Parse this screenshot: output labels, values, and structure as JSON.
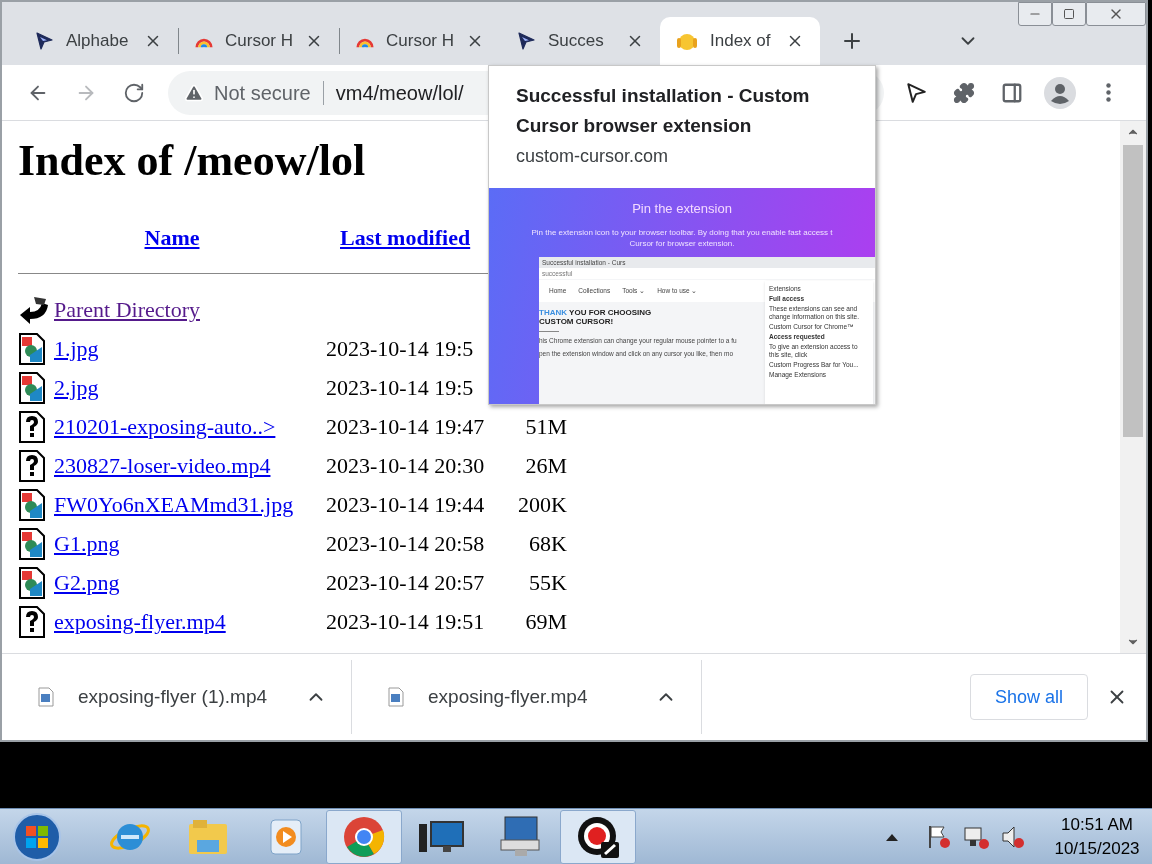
{
  "window_controls": [
    {
      "kind": "minimize"
    },
    {
      "kind": "maximize"
    },
    {
      "kind": "close"
    }
  ],
  "tabs": [
    {
      "title": "Alphabe",
      "kind": "cursor",
      "selected": false
    },
    {
      "title": "Cursor H",
      "kind": "rainbow",
      "selected": false
    },
    {
      "title": "Cursor H",
      "kind": "rainbow",
      "selected": false
    },
    {
      "title": "Succes",
      "kind": "cursor",
      "selected": false
    },
    {
      "title": "Index of",
      "kind": "emoji",
      "selected": true
    }
  ],
  "nav": [
    {
      "kind": "back",
      "disabled": false
    },
    {
      "kind": "forward",
      "disabled": true
    },
    {
      "kind": "reload",
      "disabled": false
    }
  ],
  "address": {
    "security": "Not secure",
    "url": "vm4/meow/lol/"
  },
  "toolbar_icons": [
    {
      "kind": "cursor"
    },
    {
      "kind": "extensions"
    },
    {
      "kind": "sidebar"
    },
    {
      "kind": "profile"
    },
    {
      "kind": "menu"
    }
  ],
  "page": {
    "heading": "Index of /meow/lol",
    "columns": [
      "Name",
      "Last modified"
    ],
    "entries": [
      {
        "kind": "parent",
        "name": "Parent Directory"
      },
      {
        "kind": "image",
        "name": "1.jpg",
        "modified": "2023-10-14 19:5"
      },
      {
        "kind": "image",
        "name": "2.jpg",
        "modified": "2023-10-14 19:5"
      },
      {
        "kind": "unknown",
        "name": "210201-exposing-auto..>",
        "modified": "2023-10-14 19:47",
        "size": "51M"
      },
      {
        "kind": "unknown",
        "name": "230827-loser-video.mp4",
        "modified": "2023-10-14 20:30",
        "size": "26M"
      },
      {
        "kind": "image",
        "name": "FW0Yo6nXEAMmd31.jpg",
        "modified": "2023-10-14 19:44",
        "size": "200K"
      },
      {
        "kind": "image",
        "name": "G1.png",
        "modified": "2023-10-14 20:58",
        "size": "68K"
      },
      {
        "kind": "image",
        "name": "G2.png",
        "modified": "2023-10-14 20:57",
        "size": "55K"
      },
      {
        "kind": "unknown",
        "name": "exposing-flyer.mp4",
        "modified": "2023-10-14 19:51",
        "size": "69M"
      }
    ]
  },
  "popover": {
    "title": "Successful installation - Custom Cursor browser extension",
    "domain": "custom-cursor.com",
    "preview": {
      "heading": "Pin the extension",
      "lines": [
        "Pin the extension icon to your browser toolbar. By doing that you enable fast access t",
        "Cursor for browser extension."
      ],
      "mini_tab": "Successful installation - Curs",
      "mini_address": "successful",
      "menu": [
        "Home",
        "Collections",
        "Tools ⌄",
        "How to use ⌄"
      ],
      "headline_accent": "THANK",
      "headline_rest": "YOU FOR CHOOSING",
      "headline_line2": "CUSTOM CURSOR!",
      "body": [
        "his Chrome extension can change your regular mouse pointer to a fu",
        "pen the extension window and click on any cursor you like, then mo"
      ],
      "panel": {
        "title": "Extensions",
        "full_access": "Full access",
        "full_access_note": "These extensions can see and change information on this site.",
        "ext1": "Custom Cursor for Chrome™",
        "access_requested": "Access requested",
        "access_note": "To give an extension access to this site, click",
        "ext2": "Custom Progress Bar for You...",
        "manage": "Manage Extensions"
      }
    }
  },
  "downloads": {
    "items": [
      {
        "name": "exposing-flyer (1).mp4"
      },
      {
        "name": "exposing-flyer.mp4"
      }
    ],
    "show_all": "Show all"
  },
  "taskbar": {
    "apps": [
      {
        "kind": "ie",
        "running": false
      },
      {
        "kind": "explorer",
        "running": false
      },
      {
        "kind": "media",
        "running": false
      },
      {
        "kind": "chrome",
        "running": true
      },
      {
        "kind": "monitor",
        "running": false
      },
      {
        "kind": "keyboard",
        "running": false
      },
      {
        "kind": "recorder",
        "running": true
      }
    ],
    "time": "10:51 AM",
    "date": "10/15/2023"
  }
}
